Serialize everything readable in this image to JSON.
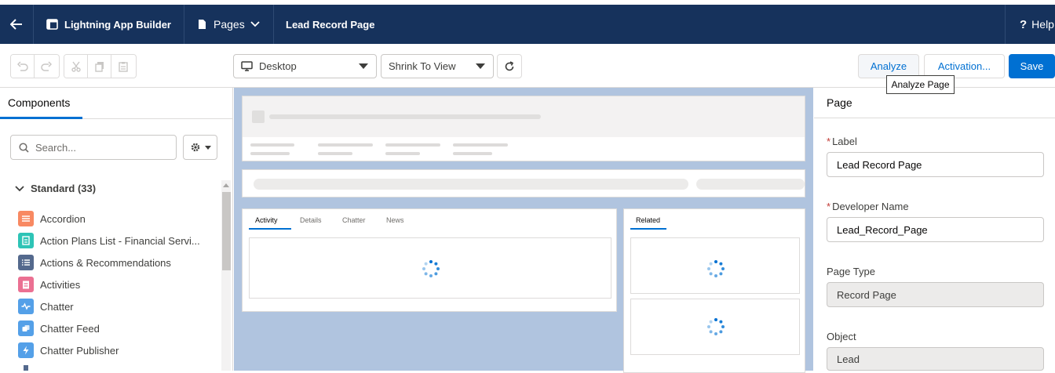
{
  "topbar": {
    "app_name": "Lightning App Builder",
    "pages_label": "Pages",
    "page_title": "Lead Record Page",
    "help_label": "Help"
  },
  "toolbar": {
    "device": "Desktop",
    "view_mode": "Shrink To View",
    "analyze_label": "Analyze",
    "activation_label": "Activation...",
    "save_label": "Save",
    "tooltip": "Analyze Page"
  },
  "left_panel": {
    "tab_label": "Components",
    "search_placeholder": "Search...",
    "section_label": "Standard (33)",
    "items": [
      {
        "label": "Accordion",
        "color": "#f88962"
      },
      {
        "label": "Action Plans List - Financial Servi...",
        "color": "#2ec4b6"
      },
      {
        "label": "Actions & Recommendations",
        "color": "#54698d"
      },
      {
        "label": "Activities",
        "color": "#eb7092"
      },
      {
        "label": "Chatter",
        "color": "#54a0e8"
      },
      {
        "label": "Chatter Feed",
        "color": "#54a0e8"
      },
      {
        "label": "Chatter Publisher",
        "color": "#54a0e8"
      }
    ]
  },
  "canvas": {
    "tabs_left": [
      "Activity",
      "Details",
      "Chatter",
      "News"
    ],
    "tab_right": "Related"
  },
  "right_panel": {
    "title": "Page",
    "label_field": {
      "label": "Label",
      "value": "Lead Record Page"
    },
    "dev_name_field": {
      "label": "Developer Name",
      "value": "Lead_Record_Page"
    },
    "page_type_field": {
      "label": "Page Type",
      "value": "Record Page"
    },
    "object_field": {
      "label": "Object",
      "value": "Lead"
    }
  },
  "colors": {
    "header_bg": "#16325c",
    "brand_blue": "#0070d2",
    "canvas_bg": "#b0c4df"
  }
}
